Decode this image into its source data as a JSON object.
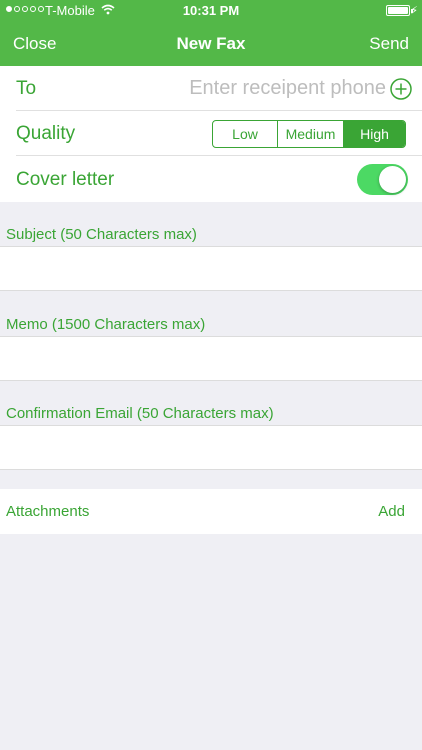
{
  "status_bar": {
    "carrier": "T-Mobile",
    "time": "10:31 PM",
    "signal_bars_filled": 1,
    "signal_bars_total": 5
  },
  "nav": {
    "left": "Close",
    "title": "New Fax",
    "right": "Send"
  },
  "form": {
    "to_label": "To",
    "to_placeholder": "Enter receipent phone",
    "quality_label": "Quality",
    "quality_options": [
      "Low",
      "Medium",
      "High"
    ],
    "quality_selected": "High",
    "cover_letter_label": "Cover letter",
    "cover_letter_on": true
  },
  "sections": {
    "subject_label": "Subject (50 Characters max)",
    "memo_label": "Memo (1500 Characters max)",
    "email_label": "Confirmation Email (50 Characters max)"
  },
  "attachments": {
    "label": "Attachments",
    "add": "Add"
  },
  "colors": {
    "nav_bg": "#53b848",
    "accent": "#3aa535",
    "toggle_on": "#4cd964",
    "background": "#efeff4"
  }
}
